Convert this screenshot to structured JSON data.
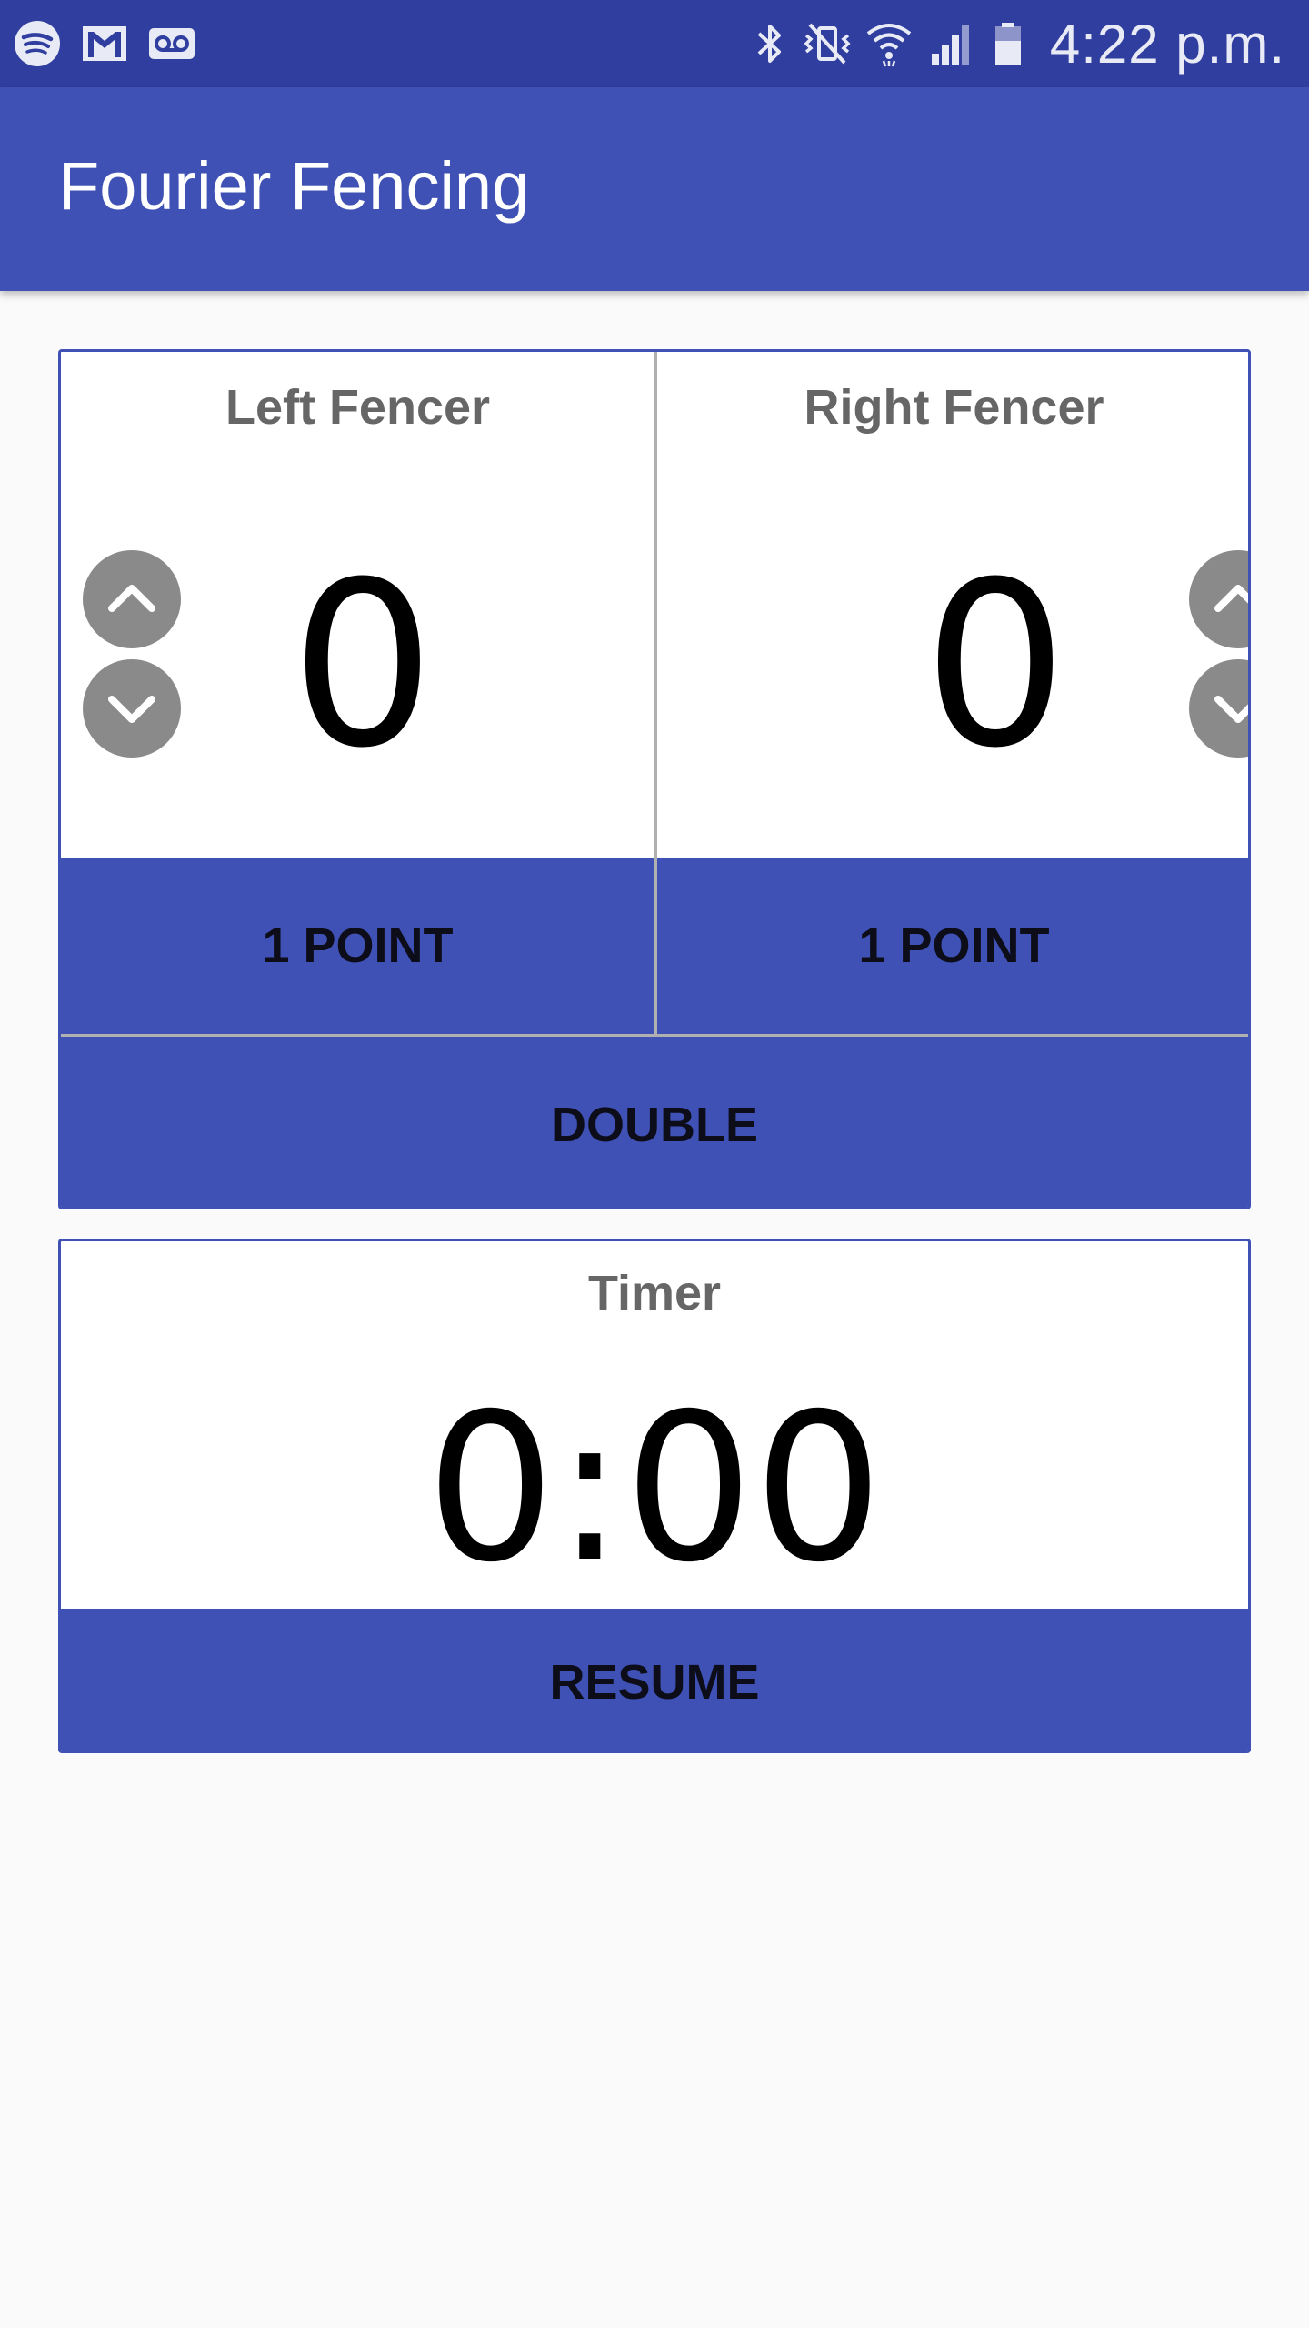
{
  "status_bar": {
    "left_icons": [
      "spotify-icon",
      "gmail-icon",
      "voicemail-icon"
    ],
    "right_icons": [
      "bluetooth-icon",
      "vibrate-icon",
      "wifi-icon",
      "signal-icon",
      "battery-icon"
    ],
    "time": "4:22 p.m."
  },
  "app_bar": {
    "title": "Fourier Fencing"
  },
  "scoreboard": {
    "left": {
      "name": "Left Fencer",
      "score": "0",
      "point_label": "1 POINT"
    },
    "right": {
      "name": "Right Fencer",
      "score": "0",
      "point_label": "1 POINT"
    },
    "double_label": "DOUBLE"
  },
  "timer": {
    "label": "Timer",
    "value": "0:00",
    "resume_label": "RESUME"
  },
  "colors": {
    "status_bar": "#303f9f",
    "primary": "#3f51b5",
    "background": "#fafafa",
    "arrow_button": "#8a8a8a"
  }
}
